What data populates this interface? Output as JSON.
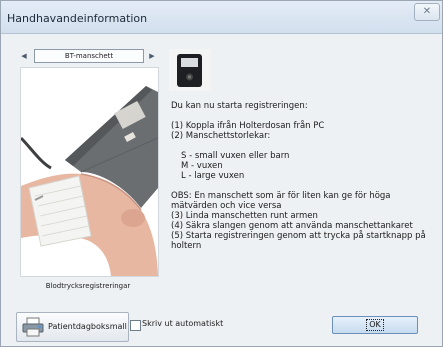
{
  "window": {
    "title": "Handhavandeinformation",
    "close_glyph": "✕"
  },
  "carousel": {
    "label": "BT-manschett",
    "prev_glyph": "◀",
    "next_glyph": "▶"
  },
  "image_caption": "Blodtrycksregistreringar",
  "instructions": {
    "intro": "Du kan nu starta registreringen:",
    "step1": "(1) Koppla ifrån Holterdosan från PC",
    "step2": "(2) Manschettstorlekar:",
    "size_s": "S - small vuxen eller barn",
    "size_m": "M - vuxen",
    "size_l": "L - large vuxen",
    "note1": "OBS: En manschett som är för liten kan ge för höga",
    "note2": "mätvärden och vice versa",
    "step3": "(3) Linda manschetten runt armen",
    "step4": "(4) Säkra slangen genom att använda manschettankaret",
    "step5": "(5) Starta registreringen genom att trycka på startknapp på",
    "step5b": "holtern"
  },
  "buttons": {
    "patient_diary": "Patientdagboksmall",
    "print_auto": "Skriv ut automatiskt",
    "ok": "OK"
  },
  "icons": {
    "close": "close-icon",
    "printer": "printer-icon",
    "device": "holter-device-icon"
  },
  "colors": {
    "accent": "#c7dbef",
    "cuff": "#6b6e70"
  }
}
